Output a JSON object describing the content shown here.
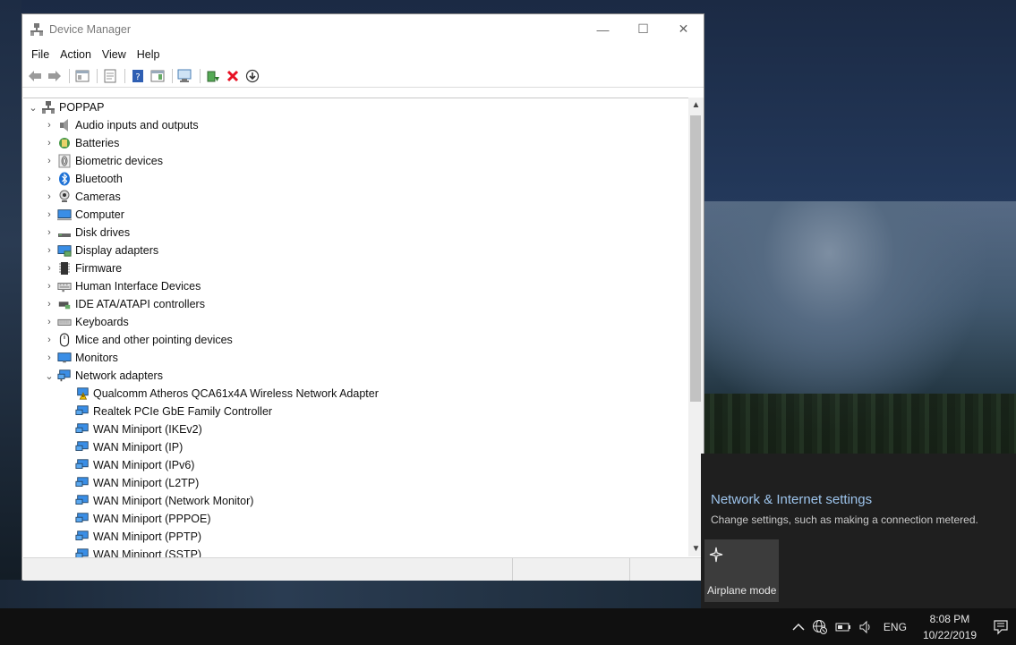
{
  "window": {
    "title": "Device Manager",
    "controls": {
      "minimize": "—",
      "maximize": "☐",
      "close": "✕"
    }
  },
  "menu": [
    "File",
    "Action",
    "View",
    "Help"
  ],
  "tree": {
    "root": "POPPAP",
    "categories": [
      {
        "label": "Audio inputs and outputs",
        "icon": "speaker-icon"
      },
      {
        "label": "Batteries",
        "icon": "battery-icon"
      },
      {
        "label": "Biometric devices",
        "icon": "fingerprint-icon"
      },
      {
        "label": "Bluetooth",
        "icon": "bluetooth-icon"
      },
      {
        "label": "Cameras",
        "icon": "camera-icon"
      },
      {
        "label": "Computer",
        "icon": "computer-icon"
      },
      {
        "label": "Disk drives",
        "icon": "disk-icon"
      },
      {
        "label": "Display adapters",
        "icon": "display-adapter-icon"
      },
      {
        "label": "Firmware",
        "icon": "firmware-icon"
      },
      {
        "label": "Human Interface Devices",
        "icon": "hid-icon"
      },
      {
        "label": "IDE ATA/ATAPI controllers",
        "icon": "ide-icon"
      },
      {
        "label": "Keyboards",
        "icon": "keyboard-icon"
      },
      {
        "label": "Mice and other pointing devices",
        "icon": "mouse-icon"
      },
      {
        "label": "Monitors",
        "icon": "monitor-icon"
      },
      {
        "label": "Network adapters",
        "icon": "network-icon"
      }
    ],
    "network_children": [
      "Qualcomm Atheros QCA61x4A Wireless Network Adapter",
      "Realtek PCIe GbE Family Controller",
      "WAN Miniport (IKEv2)",
      "WAN Miniport (IP)",
      "WAN Miniport (IPv6)",
      "WAN Miniport (L2TP)",
      "WAN Miniport (Network Monitor)",
      "WAN Miniport (PPPOE)",
      "WAN Miniport (PPTP)",
      "WAN Miniport (SSTP)"
    ]
  },
  "flyout": {
    "title": "Network & Internet settings",
    "description": "Change settings, such as making a connection metered.",
    "airplane_label": "Airplane mode"
  },
  "taskbar": {
    "language": "ENG",
    "time": "8:08 PM",
    "date": "10/22/2019"
  },
  "colors": {
    "link": "#9dc4ec",
    "network_icon": "#3a8ee6",
    "error_red": "#e81123"
  }
}
